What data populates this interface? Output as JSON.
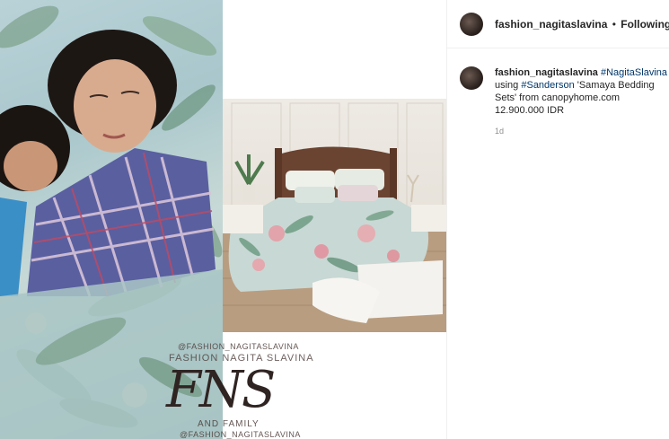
{
  "post": {
    "watermark": {
      "handle_top": "@FASHION_NAGITASLAVINA",
      "brand_name": "FASHION NAGITA SLAVINA",
      "monogram": "FNS",
      "family": "AND FAMILY",
      "handle_bottom": "@FASHION_NAGITASLAVINA"
    }
  },
  "header": {
    "username": "fashion_nagitaslavina",
    "separator": "•",
    "follow_status": "Following"
  },
  "caption": {
    "username": "fashion_nagitaslavina",
    "hashtag_1": "#NagitaSlavina",
    "text_1": "using",
    "hashtag_2": "#Sanderson",
    "text_2": "'Samaya Bedding Sets' from canopyhome.com 12.900.000 IDR",
    "time": "1d"
  },
  "colors": {
    "link": "#00376b",
    "text": "#262626",
    "muted": "#8e8e8e",
    "border": "#efefef"
  }
}
